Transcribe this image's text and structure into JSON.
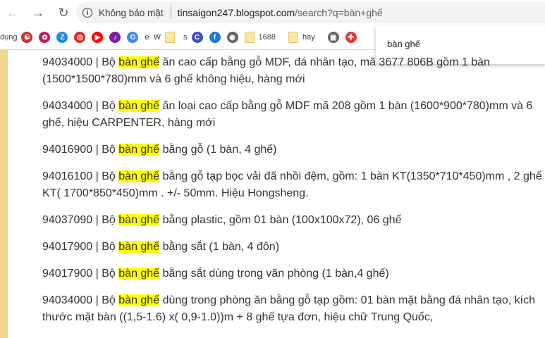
{
  "browser": {
    "security_label": "Không bảo mật",
    "url_host": "tinsaigon247.blogspot.com",
    "url_path": "/search?q=bàn+ghế",
    "suggestion": "bàn ghế"
  },
  "bookmarks": [
    {
      "label": "dụng",
      "icon": "none",
      "color": ""
    },
    {
      "label": "",
      "icon": "yin-yang-icon",
      "color": "#d32f2f"
    },
    {
      "label": "",
      "icon": "flower-icon",
      "color": "#c2185b"
    },
    {
      "label": "",
      "icon": "z-icon",
      "color": "#1e88e5"
    },
    {
      "label": "",
      "icon": "target-icon",
      "color": "#d32f2f"
    },
    {
      "label": "",
      "icon": "youtube-icon",
      "color": "#ff0000"
    },
    {
      "label": "",
      "icon": "music-icon",
      "color": "#7b1fa2"
    },
    {
      "label": "",
      "icon": "google-icon",
      "color": "#4285f4"
    },
    {
      "label": "e",
      "icon": "none",
      "color": ""
    },
    {
      "label": "W",
      "icon": "none",
      "color": ""
    },
    {
      "label": "",
      "icon": "folder-icon",
      "color": "#f8e8a6"
    },
    {
      "label": "s",
      "icon": "none",
      "color": ""
    },
    {
      "label": "",
      "icon": "c-icon",
      "color": "#3f51b5"
    },
    {
      "label": "",
      "icon": "facebook-icon",
      "color": "#1877f2"
    },
    {
      "label": "",
      "icon": "globe-icon",
      "color": "#5f6368"
    },
    {
      "label": "1688",
      "icon": "folder-icon",
      "color": "#f8e8a6"
    },
    {
      "label": "hay",
      "icon": "folder-icon",
      "color": "#f8e8a6"
    },
    {
      "label": "",
      "icon": "box-icon",
      "color": "#5f6368"
    },
    {
      "label": "",
      "icon": "game-icon",
      "color": "#e53935"
    }
  ],
  "highlight_term": "bàn ghế",
  "entries": [
    {
      "code": "94034000",
      "before": "Bộ",
      "after": "ăn cao cấp bằng gỗ MDF, đá nhân tạo, mã 3677 806B gồm 1 bàn (1500*1500*780)mm và 6 ghế không hiệu, hàng mới"
    },
    {
      "code": "94034000",
      "before": "Bộ",
      "after": "ăn loại cao cấp bằng gỗ MDF mã 208 gồm 1 bàn (1600*900*780)mm và 6 ghế, hiệu CARPENTER, hàng mới"
    },
    {
      "code": "94016900",
      "before": "Bộ",
      "after": "bằng gỗ (1 bàn, 4 ghế)"
    },
    {
      "code": "94016100",
      "before": "Bộ",
      "after": "bằng gỗ tạp bọc vải đã nhồi đệm, gồm: 1 bàn KT(1350*710*450)mm , 2 ghế KT( 1700*850*450)mm . +/- 50mm. Hiệu Hongsheng."
    },
    {
      "code": "94037090",
      "before": "Bộ",
      "after": "bằng plastic, gồm 01 bàn (100x100x72), 06 ghế"
    },
    {
      "code": "94017900",
      "before": "Bộ",
      "after": "bằng sắt (1 bàn, 4 đôn)"
    },
    {
      "code": "94017900",
      "before": "Bộ",
      "after": "bằng sắt dùng trong văn phòng (1 bàn,4 ghế)"
    },
    {
      "code": "94034000",
      "before": "Bộ",
      "after": "dùng trong phòng ăn bằng gỗ tạp gồm: 01 bàn mặt bằng đá nhân tạo, kích thước mặt bàn ((1,5-1.6) x( 0,9-1.0))m + 8 ghế tựa đơn, hiệu chữ Trung Quốc,"
    }
  ]
}
